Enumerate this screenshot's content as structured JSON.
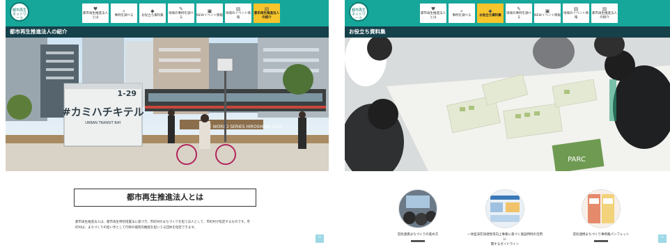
{
  "left_page": {
    "logo_text": [
      "都市再生",
      "ネットワーク"
    ],
    "nav": [
      {
        "icon": "♥",
        "label": [
          "都市再生推進法人",
          "とは"
        ],
        "active": false
      },
      {
        "icon": "⌕",
        "label": [
          "事例を調べる"
        ],
        "active": false
      },
      {
        "icon": "◆",
        "label": [
          "お役立ち資料集"
        ],
        "active": false
      },
      {
        "icon": "✎",
        "label": [
          "地域の事例を調べ",
          "る"
        ],
        "active": false
      },
      {
        "icon": "▣",
        "label": [
          "NEWイベント情報"
        ],
        "active": false
      },
      {
        "icon": "▤",
        "label": [
          "地域のイベント情",
          "報"
        ],
        "active": false
      },
      {
        "icon": "▤",
        "label": [
          "都市再生推進法人",
          "の紹介"
        ],
        "active": true
      }
    ],
    "section_title": "都市再生推進法人の紹介",
    "photo_texts": {
      "container_brand": "#カミハチキテル",
      "container_sub": "URBAN TRANSIT BAY",
      "container_number": "1-29",
      "banner": "FISE WORLD SERIES HIROSHIMA 2020"
    },
    "heading": "都市再生推進法人とは",
    "body_text": [
      "都市再生推進法人は、都市再生特別措置法に基づき、市町村のまちづくりを担う法人として、市町村が指定するものです。市",
      "町村は、まちづくりの担い手として行政の補完的機能を担いうる団体を指定できます。"
    ],
    "back_to_top": "^"
  },
  "right_page": {
    "logo_text": [
      "都市再生",
      "ネットワーク"
    ],
    "nav": [
      {
        "icon": "♥",
        "label": [
          "都市再生推進法人",
          "とは"
        ],
        "active": false
      },
      {
        "icon": "⌕",
        "label": [
          "事例を調べる"
        ],
        "active": false
      },
      {
        "icon": "◆",
        "label": [
          "お役立ち資料集"
        ],
        "active": true
      },
      {
        "icon": "✎",
        "label": [
          "地域の事例を調べ",
          "る"
        ],
        "active": false
      },
      {
        "icon": "▣",
        "label": [
          "NEWイベント情報"
        ],
        "active": false
      },
      {
        "icon": "▤",
        "label": [
          "地域のイベント情",
          "報"
        ],
        "active": false
      },
      {
        "icon": "▤",
        "label": [
          "都市再生推進法人",
          "の紹介"
        ],
        "active": false
      }
    ],
    "section_title": "お役立ち資料集",
    "photo_texts": {
      "board_label": "PARC"
    },
    "cards": [
      {
        "title": [
          "官民連携まちづくりの進め方"
        ]
      },
      {
        "title": [
          "一体型滞在快適性等向上事業に基づく施設特例の活用に",
          "関するガイドライン"
        ]
      },
      {
        "title": [
          "官民連携まちづくり事例集パンフレット"
        ]
      }
    ],
    "back_to_top": "^"
  }
}
